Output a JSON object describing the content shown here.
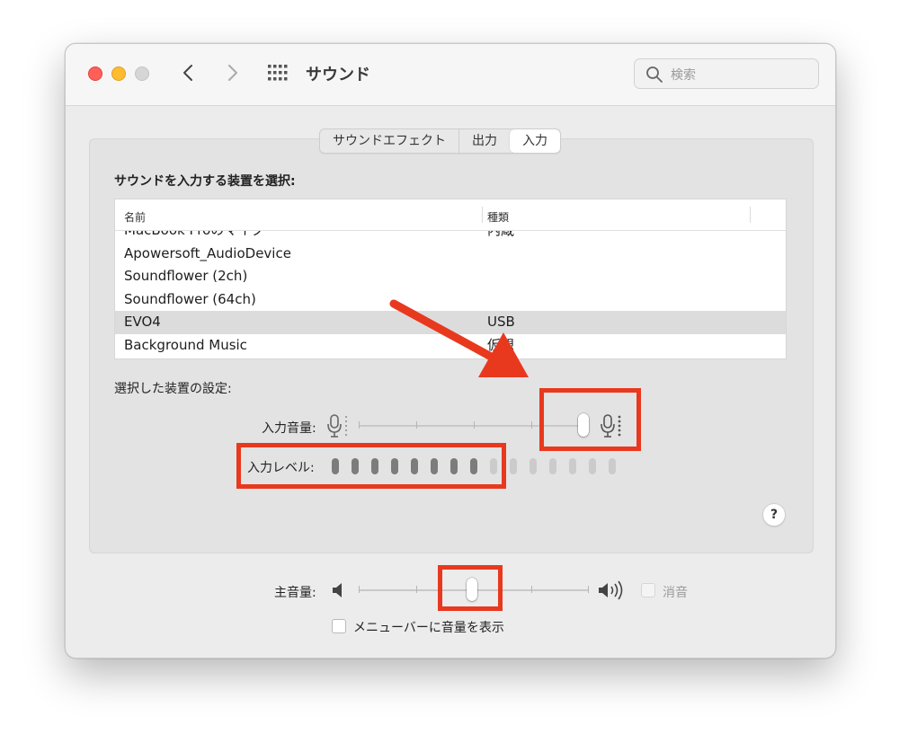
{
  "window": {
    "title": "サウンド",
    "search_placeholder": "検索"
  },
  "tabs": [
    {
      "label": "サウンドエフェクト",
      "active": false
    },
    {
      "label": "出力",
      "active": false
    },
    {
      "label": "入力",
      "active": true
    }
  ],
  "input": {
    "select_label": "サウンドを入力する装置を選択:",
    "columns": {
      "name": "名前",
      "type": "種類"
    },
    "devices": [
      {
        "name": "MacBook Proのマイク",
        "type": "内蔵",
        "selected": false
      },
      {
        "name": "Apowersoft_AudioDevice",
        "type": "",
        "selected": false
      },
      {
        "name": "Soundflower (2ch)",
        "type": "",
        "selected": false
      },
      {
        "name": "Soundflower (64ch)",
        "type": "",
        "selected": false
      },
      {
        "name": "EVO4",
        "type": "USB",
        "selected": true
      },
      {
        "name": "Background Music",
        "type": "仮想",
        "selected": false
      }
    ],
    "settings_label": "選択した装置の設定:",
    "volume_label": "入力音量:",
    "volume_level": 0.92,
    "level_label": "入力レベル:",
    "level_segments_total": 15,
    "level_segments_active": 8
  },
  "output": {
    "main_volume_label": "主音量:",
    "main_volume_level": 0.5,
    "mute_label": "消音",
    "mute_checked": false,
    "menubar_label": "メニューバーに音量を表示",
    "menubar_checked": false
  },
  "annotation_color": "#e8391f",
  "icons": [
    "close-light",
    "minimize-light",
    "zoom-light",
    "chevron-left-icon",
    "chevron-right-icon",
    "grid-icon",
    "search-icon",
    "microphone-icon",
    "speaker-icon",
    "help-icon"
  ]
}
